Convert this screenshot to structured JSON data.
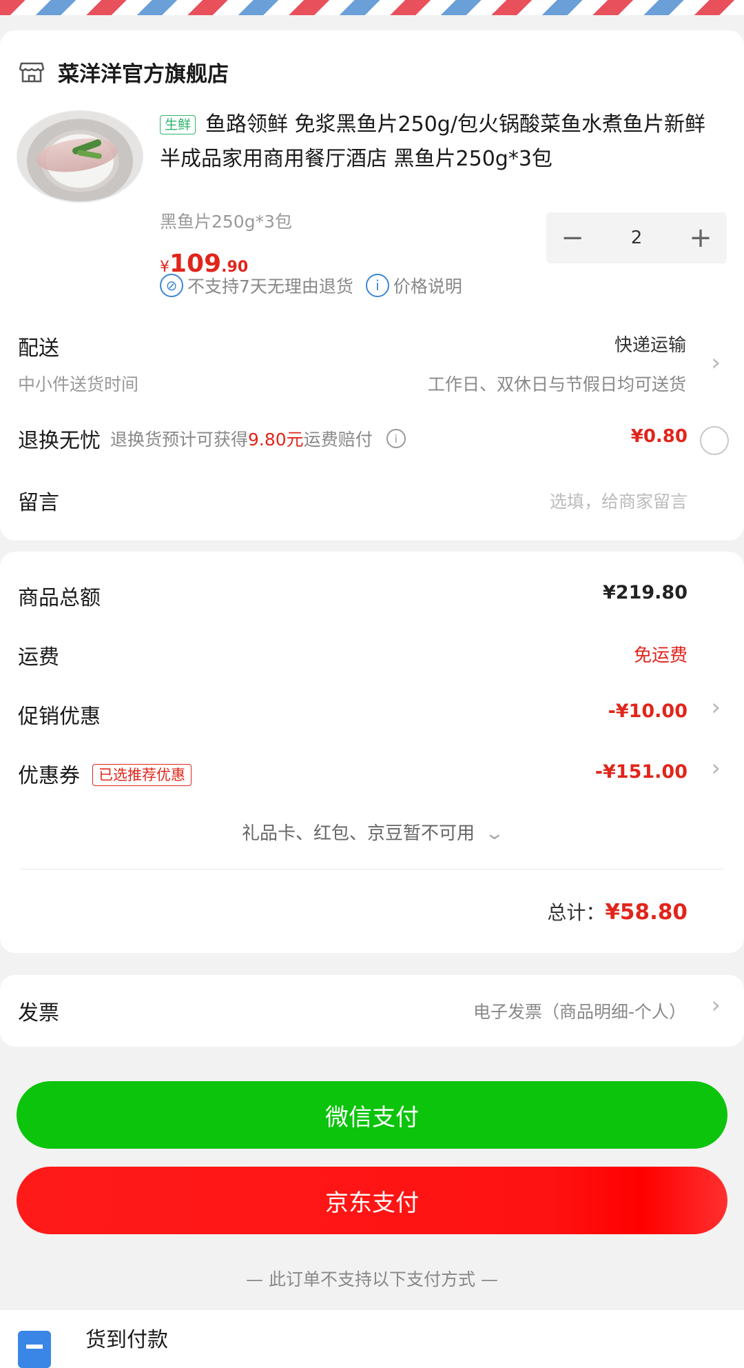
{
  "store": {
    "name": "菜洋洋官方旗舰店",
    "icon": "store-icon"
  },
  "product": {
    "tag": "生鲜",
    "title": "鱼路领鲜 免浆黑鱼片250g/包火锅酸菜鱼水煮鱼片新鲜半成品家用商用餐厅酒店 黑鱼片250g*3包",
    "spec": "黑鱼片250g*3包",
    "price_currency": "¥",
    "price_int": "109",
    "price_dec": ".90",
    "quantity": "2",
    "minus": "−",
    "plus": "+",
    "note_no_return": "不支持7天无理由退货",
    "note_price": "价格说明"
  },
  "delivery": {
    "label": "配送",
    "method": "快递运输",
    "sub_label": "中小件送货时间",
    "sub_value": "工作日、双休日与节假日均可送货"
  },
  "return_worry": {
    "label": "退换无忧",
    "desc_prefix": "退换货预计可获得",
    "desc_amount": "9.80元",
    "desc_suffix": "运费赔付",
    "price": "¥0.80"
  },
  "message": {
    "label": "留言",
    "placeholder": "选填，给商家留言"
  },
  "summary": {
    "goods_total_label": "商品总额",
    "goods_total_value": "¥219.80",
    "shipping_label": "运费",
    "shipping_value": "免运费",
    "promo_label": "促销优惠",
    "promo_value": "-¥10.00",
    "coupon_label": "优惠券",
    "coupon_tag": "已选推荐优惠",
    "coupon_value": "-¥151.00",
    "unavailable": "礼品卡、红包、京豆暂不可用",
    "total_label": "总计：",
    "total_value": "¥58.80"
  },
  "invoice": {
    "label": "发票",
    "value": "电子发票（商品明细-个人）"
  },
  "payment": {
    "wechat": "微信支付",
    "jd": "京东支付",
    "unsupported": "— 此订单不支持以下支付方式 —",
    "cod": "货到付款"
  },
  "colors": {
    "accent_red": "#e1251b",
    "wechat_green": "#0bc40b",
    "fresh_green": "#2bb46a",
    "info_blue": "#3a86d6"
  }
}
